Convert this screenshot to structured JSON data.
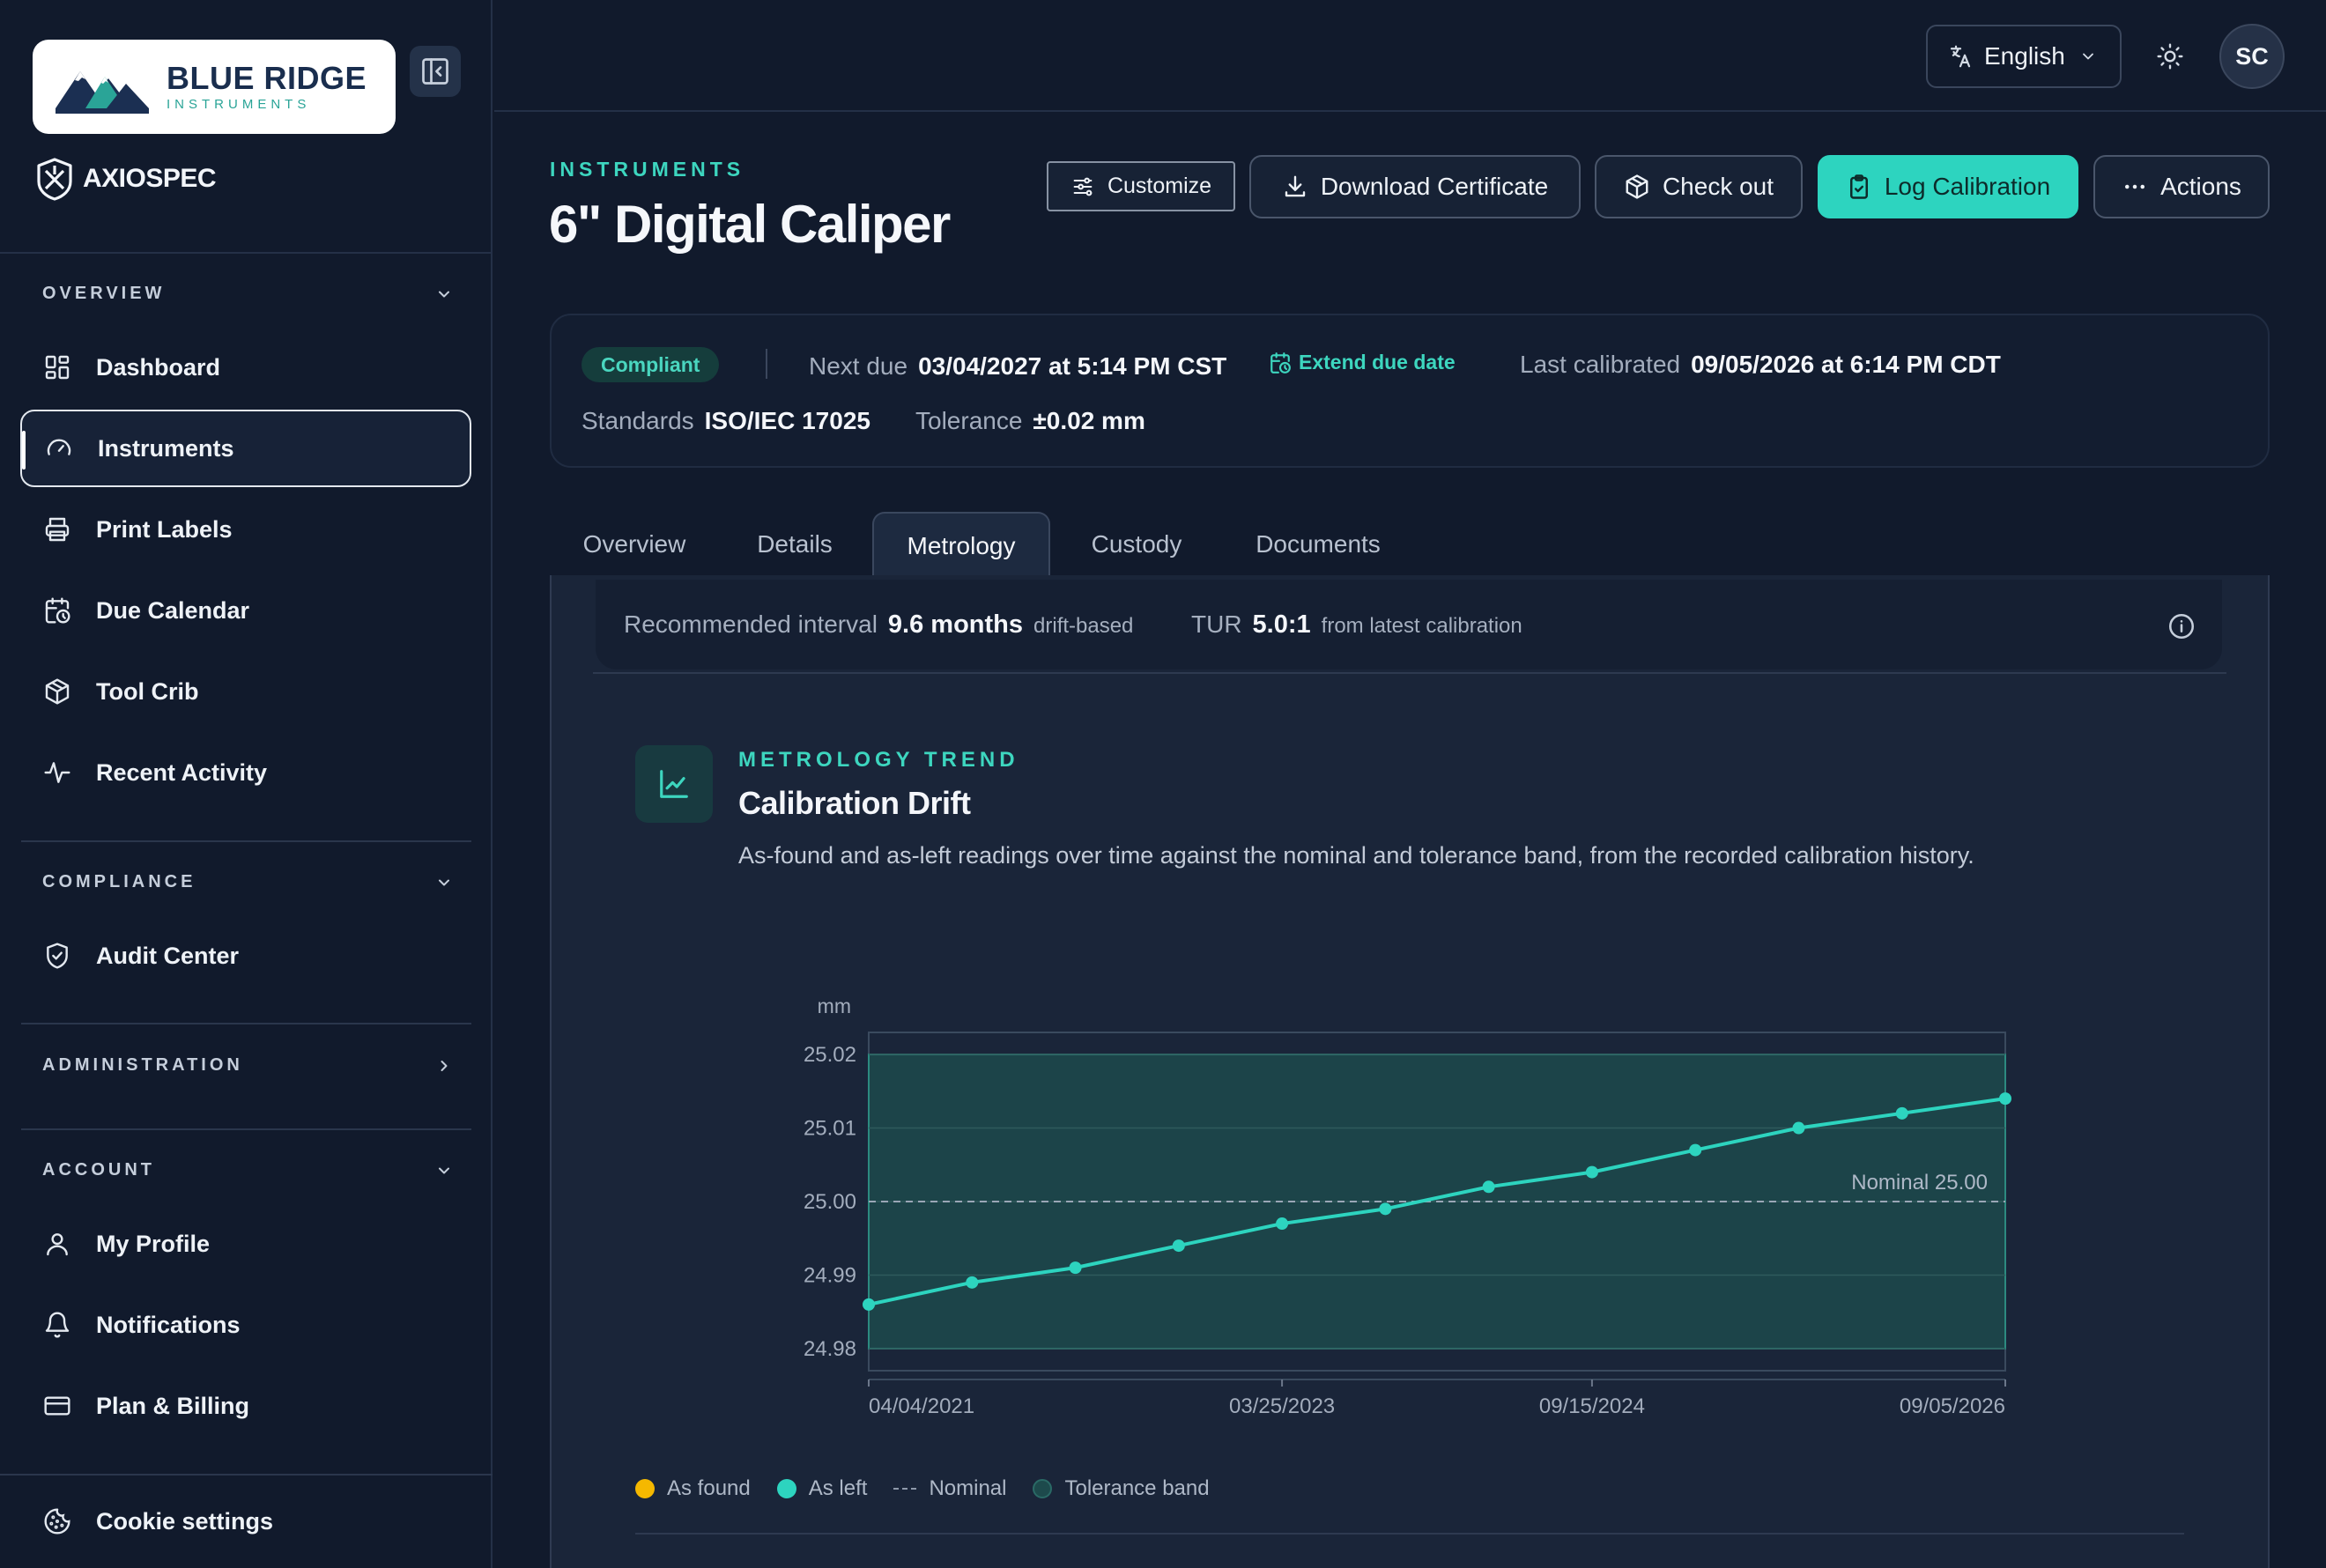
{
  "sidebar": {
    "brand": {
      "title": "BLUE RIDGE",
      "subtitle": "INSTRUMENTS"
    },
    "product": "AXIOSPEC",
    "sections": {
      "overview": "OVERVIEW",
      "compliance": "COMPLIANCE",
      "administration": "ADMINISTRATION",
      "account": "ACCOUNT"
    },
    "items": {
      "dashboard": "Dashboard",
      "instruments": "Instruments",
      "print_labels": "Print Labels",
      "due_calendar": "Due Calendar",
      "tool_crib": "Tool Crib",
      "recent_activity": "Recent Activity",
      "audit_center": "Audit Center",
      "my_profile": "My Profile",
      "notifications": "Notifications",
      "plan_billing": "Plan & Billing",
      "cookie_settings": "Cookie settings"
    },
    "active": "instruments"
  },
  "topbar": {
    "language": "English",
    "avatar_initials": "SC"
  },
  "header": {
    "breadcrumb": "INSTRUMENTS",
    "title": "6\" Digital Caliper",
    "buttons": {
      "customize": "Customize",
      "download": "Download Certificate",
      "checkout": "Check out",
      "log": "Log Calibration",
      "actions": "Actions"
    }
  },
  "status": {
    "badge": "Compliant",
    "next_due_label": "Next due",
    "next_due_value": "03/04/2027 at 5:14 PM CST",
    "extend": "Extend due date",
    "last_cal_label": "Last calibrated",
    "last_cal_value": "09/05/2026 at 6:14 PM CDT",
    "standards_label": "Standards",
    "standards_value": "ISO/IEC 17025",
    "tolerance_label": "Tolerance",
    "tolerance_value": "±0.02 mm"
  },
  "tabs": [
    "Overview",
    "Details",
    "Metrology",
    "Custody",
    "Documents"
  ],
  "active_tab": "Metrology",
  "interval": {
    "rec_label": "Recommended interval",
    "rec_value": "9.6 months",
    "rec_sub": "drift-based",
    "tur_label": "TUR",
    "tur_value": "5.0:1",
    "tur_sub": "from latest calibration"
  },
  "trend": {
    "kicker": "METROLOGY TREND",
    "title": "Calibration Drift",
    "description": "As-found and as-left readings over time against the nominal and tolerance band, from the recorded calibration history."
  },
  "legend": {
    "as_found": "As found",
    "as_left": "As left",
    "nominal": "Nominal",
    "tolerance": "Tolerance band"
  },
  "colors": {
    "accent": "#2dd4bf",
    "as_found": "#f5b800",
    "tolerance_band": "#1d4a4c",
    "background": "#111a2c"
  },
  "chart_data": {
    "type": "line",
    "ylabel": "mm",
    "ylim": [
      24.977,
      25.023
    ],
    "yticks": [
      "25.02",
      "25.01",
      "25.00",
      "24.99",
      "24.98"
    ],
    "ytick_values": [
      25.02,
      25.01,
      25.0,
      24.99,
      24.98
    ],
    "xticks": [
      "04/04/2021",
      "03/25/2023",
      "09/15/2024",
      "09/05/2026"
    ],
    "xtick_index": [
      0,
      4,
      7,
      11
    ],
    "nominal": 25.0,
    "nominal_label": "Nominal 25.00",
    "tolerance_band": [
      24.98,
      25.02
    ],
    "series": [
      {
        "name": "As left",
        "values": [
          24.986,
          24.989,
          24.991,
          24.994,
          24.997,
          24.999,
          25.002,
          25.004,
          25.007,
          25.01,
          25.012,
          25.014
        ]
      }
    ],
    "grid": true,
    "legend_position": "bottom-left"
  }
}
